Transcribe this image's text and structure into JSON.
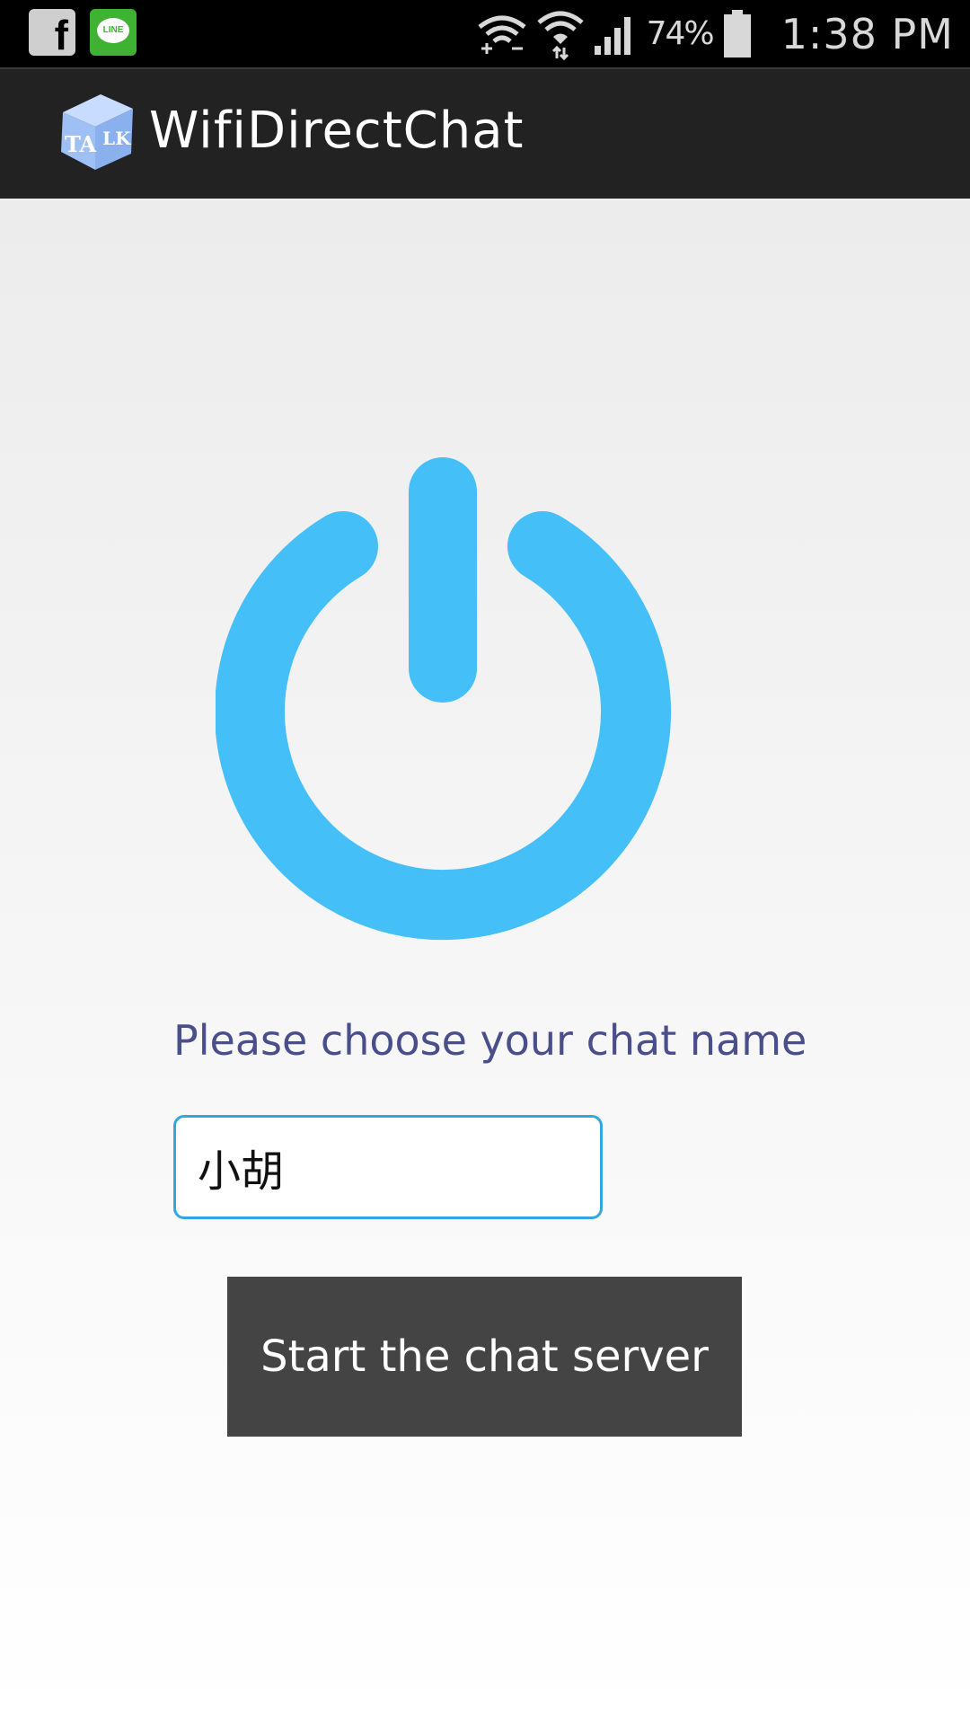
{
  "status_bar": {
    "notifications": [
      {
        "name": "facebook-notification-icon",
        "glyph": "f"
      },
      {
        "name": "line-notification-icon",
        "glyph": "LINE"
      }
    ],
    "battery_percent": "74%",
    "time": "1:38 PM",
    "icons": [
      "wifi-direct-icon",
      "wifi-icon",
      "signal-icon",
      "battery-icon"
    ]
  },
  "action_bar": {
    "app_icon_text": "TALK",
    "title": "WifiDirectChat"
  },
  "main": {
    "power_icon_color": "#45bff8",
    "prompt": "Please choose your chat name",
    "name_input": {
      "value": "小胡",
      "accent_color": "#33a6e0"
    },
    "start_button": {
      "label": "Start the chat server",
      "color": "#444444"
    }
  }
}
